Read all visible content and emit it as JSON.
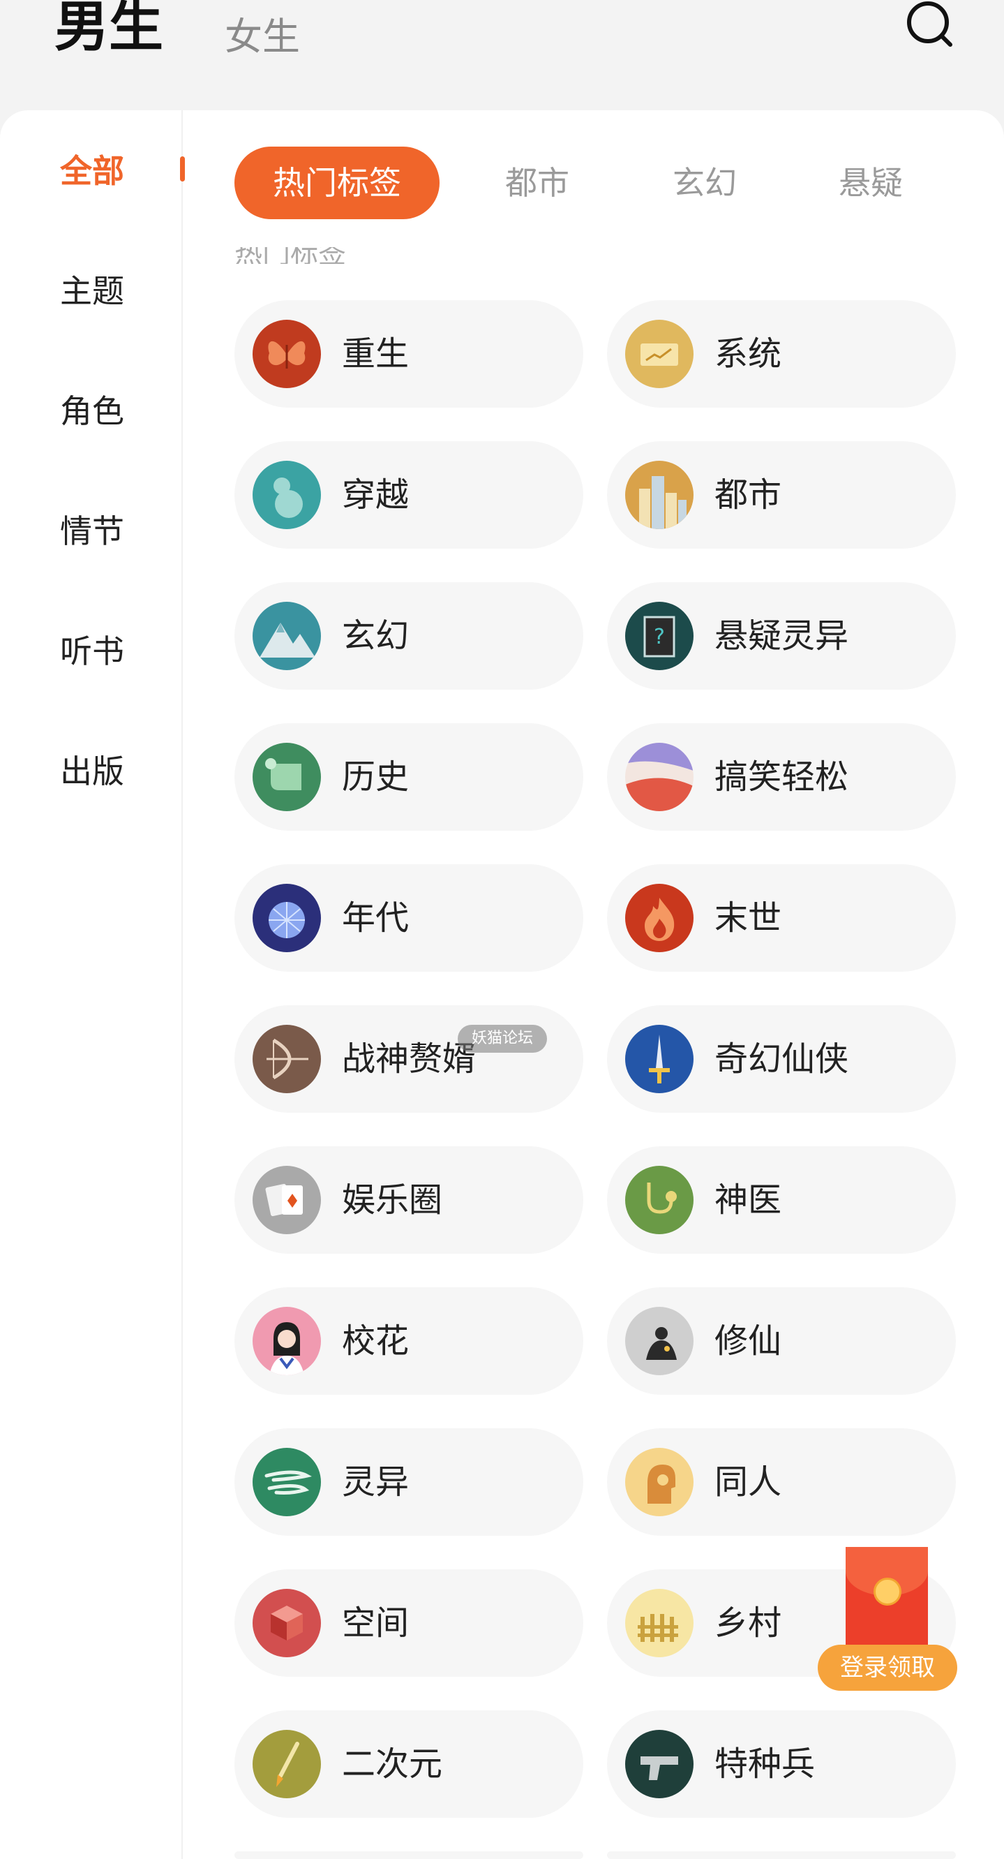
{
  "header": {
    "male_tab": "男生",
    "female_tab": "女生",
    "search_icon": "search-icon"
  },
  "sidebar": {
    "items": [
      {
        "label": "全部",
        "active": true
      },
      {
        "label": "主题",
        "active": false
      },
      {
        "label": "角色",
        "active": false
      },
      {
        "label": "情节",
        "active": false
      },
      {
        "label": "听书",
        "active": false
      },
      {
        "label": "出版",
        "active": false
      }
    ],
    "accent_color": "#f0652a"
  },
  "tabs": [
    {
      "label": "热门标签",
      "active": true
    },
    {
      "label": "都市",
      "active": false
    },
    {
      "label": "玄幻",
      "active": false
    },
    {
      "label": "悬疑",
      "active": false
    }
  ],
  "section_title": "热门标签",
  "tags": [
    {
      "label": "重生",
      "icon": "butterfly-icon"
    },
    {
      "label": "系统",
      "icon": "screen-icon"
    },
    {
      "label": "穿越",
      "icon": "gourd-icon"
    },
    {
      "label": "都市",
      "icon": "city-icon"
    },
    {
      "label": "玄幻",
      "icon": "mountain-icon"
    },
    {
      "label": "悬疑灵异",
      "icon": "mystery-book-icon"
    },
    {
      "label": "历史",
      "icon": "scroll-icon"
    },
    {
      "label": "搞笑轻松",
      "icon": "wave-icon"
    },
    {
      "label": "年代",
      "icon": "disco-ball-icon"
    },
    {
      "label": "末世",
      "icon": "fire-icon"
    },
    {
      "label": "战神赘婿",
      "icon": "bow-icon"
    },
    {
      "label": "奇幻仙侠",
      "icon": "sword-icon"
    },
    {
      "label": "娱乐圈",
      "icon": "cards-icon"
    },
    {
      "label": "神医",
      "icon": "stethoscope-icon"
    },
    {
      "label": "校花",
      "icon": "girl-icon"
    },
    {
      "label": "修仙",
      "icon": "meditation-icon"
    },
    {
      "label": "灵异",
      "icon": "wind-icon"
    },
    {
      "label": "同人",
      "icon": "profile-icon"
    },
    {
      "label": "空间",
      "icon": "cube-icon"
    },
    {
      "label": "乡村",
      "icon": "fence-icon"
    },
    {
      "label": "二次元",
      "icon": "brush-icon"
    },
    {
      "label": "特种兵",
      "icon": "pistol-icon"
    }
  ],
  "watermark": "妖猫论坛",
  "promo": {
    "button_label": "登录领取",
    "icon": "red-envelope-icon"
  }
}
